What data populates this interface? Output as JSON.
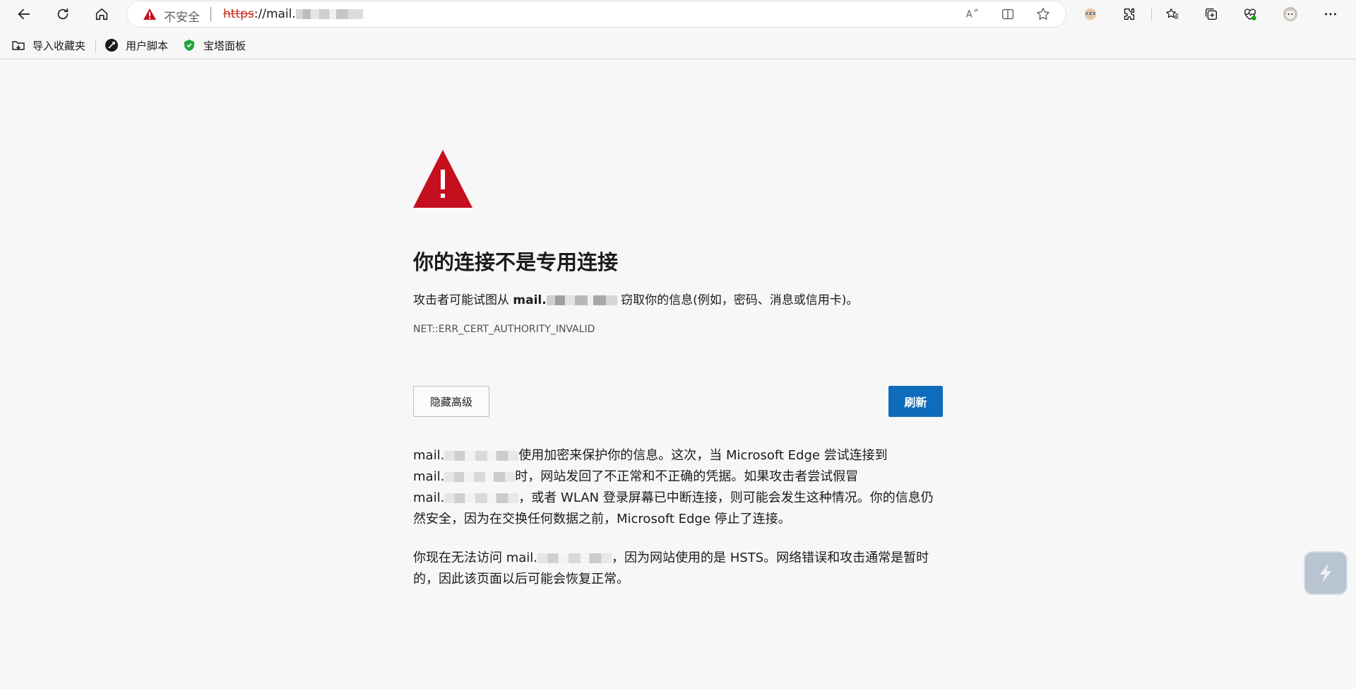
{
  "toolbar": {
    "back_icon": "arrow-left-icon",
    "refresh_icon": "refresh-icon",
    "home_icon": "home-icon"
  },
  "address_bar": {
    "security_label": "不安全",
    "url_scheme": "https",
    "url_rest": "://mail."
  },
  "favorites": [
    {
      "label": "导入收藏夹",
      "icon": "import-favorites-icon"
    },
    {
      "label": "用户脚本",
      "icon": "userscript-icon"
    },
    {
      "label": "宝塔面板",
      "icon": "shield-icon"
    }
  ],
  "error_page": {
    "title": "你的连接不是专用连接",
    "desc_prefix": "攻击者可能试图从",
    "desc_host": "mail.",
    "desc_suffix": "窃取你的信息(例如，密码、消息或信用卡)。",
    "error_code": "NET::ERR_CERT_AUTHORITY_INVALID",
    "advanced_button": "隐藏高级",
    "refresh_button": "刷新",
    "para1_line1_host": "mail.",
    "para1_line1_text": "使用加密来保护你的信息。这次，当 Microsoft Edge 尝试连接到",
    "para1_line2_host": "mail.",
    "para1_line2_text": "时，网站发回了不正常和不正确的凭据。如果攻击者尝试假冒",
    "para1_line3_host": "mail.",
    "para1_line3_text": "，或者 WLAN 登录屏幕已中断连接，则可能会发生这种情况。你的信息仍",
    "para1_line4_text": "然安全，因为在交换任何数据之前，Microsoft Edge 停止了连接。",
    "para2_prefix": "你现在无法访问",
    "para2_host": "mail.",
    "para2_line1_text": "，因为网站使用的是 HSTS。网络错误和攻击通常是暂时",
    "para2_line2_text": "的，因此该页面以后可能会恢复正常。"
  },
  "colors": {
    "warning_red": "#c50f1f",
    "refresh_blue": "#0f6cbd",
    "page_background": "#f7f7f7"
  }
}
